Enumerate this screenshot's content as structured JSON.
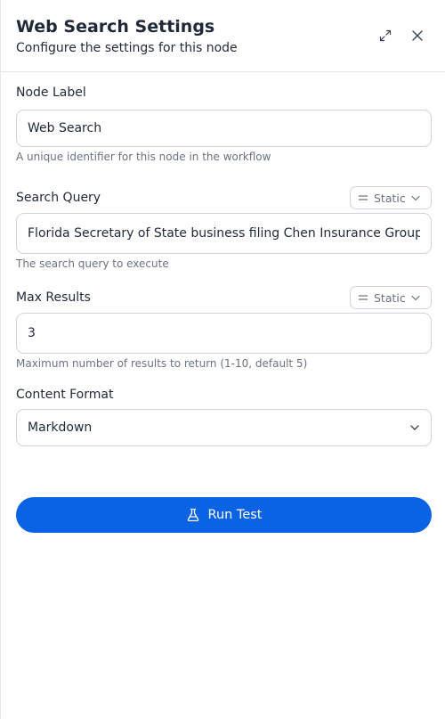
{
  "header": {
    "title": "Web Search Settings",
    "subtitle": "Configure the settings for this node",
    "expand_icon": "expand-icon",
    "close_icon": "close-icon"
  },
  "node_label": {
    "label": "Node Label",
    "value": "Web Search",
    "hint": "A unique identifier for this node in the workflow"
  },
  "search_query": {
    "label": "Search Query",
    "mode": "Static",
    "value": "Florida Secretary of State business filing Chen Insurance Group",
    "hint": "The search query to execute"
  },
  "max_results": {
    "label": "Max Results",
    "mode": "Static",
    "value": "3",
    "hint": "Maximum number of results to return (1-10, default 5)"
  },
  "content_format": {
    "label": "Content Format",
    "selected": "Markdown"
  },
  "run_button": {
    "label": "Run Test",
    "icon": "flask-icon",
    "color": "#0a63e5"
  }
}
